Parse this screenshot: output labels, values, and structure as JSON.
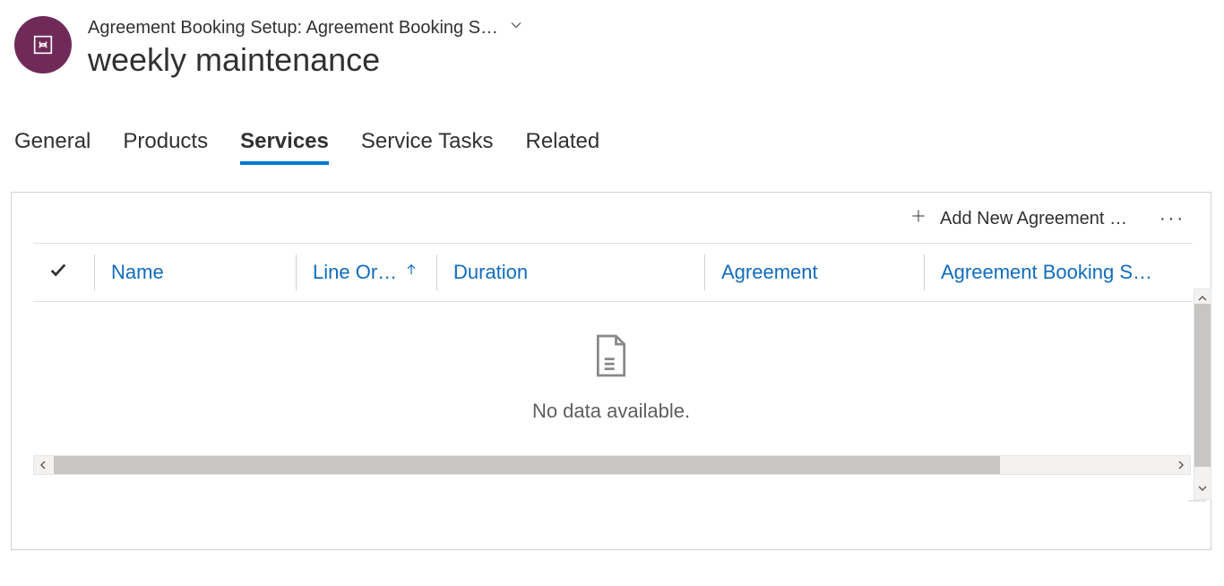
{
  "header": {
    "breadcrumb": "Agreement Booking Setup: Agreement Booking S…",
    "title": "weekly maintenance"
  },
  "tabs": [
    {
      "label": "General",
      "active": false
    },
    {
      "label": "Products",
      "active": false
    },
    {
      "label": "Services",
      "active": true
    },
    {
      "label": "Service Tasks",
      "active": false
    },
    {
      "label": "Related",
      "active": false
    }
  ],
  "toolbar": {
    "add_label": "Add New Agreement …"
  },
  "grid": {
    "columns": {
      "name": "Name",
      "line_order": "Line Or…",
      "duration": "Duration",
      "agreement": "Agreement",
      "agreement_booking_setup": "Agreement Booking S…"
    },
    "sort_column": "line_order",
    "sort_dir": "asc",
    "rows": [],
    "empty_message": "No data available."
  }
}
